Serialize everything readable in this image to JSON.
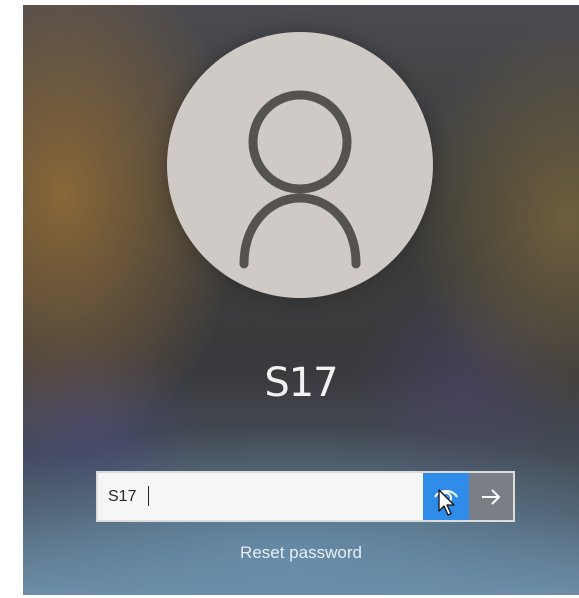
{
  "user": {
    "name": "S17",
    "avatar_icon": "user-silhouette-icon"
  },
  "password": {
    "value": "S17",
    "reveal_icon": "eye-reveal-icon",
    "submit_icon": "arrow-right-icon"
  },
  "links": {
    "reset_password": "Reset password"
  },
  "colors": {
    "reveal_button": "#2f8ce8",
    "submit_button": "#7a7f86",
    "avatar_bg": "#cfcac5"
  }
}
